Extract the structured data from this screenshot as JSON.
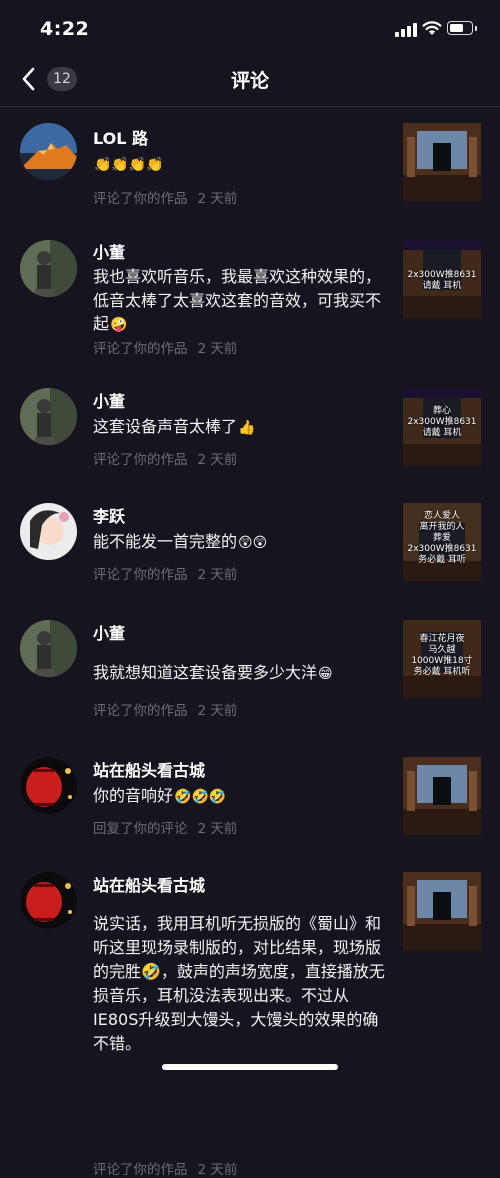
{
  "status": {
    "time": "4:22"
  },
  "nav": {
    "title": "评论",
    "badge_count": "12"
  },
  "comments": [
    {
      "username": "LOL 路",
      "text": "",
      "emoji": "👏👏👏👏",
      "action": "评论了你的作品",
      "time": "2 天前",
      "thumb_text": "",
      "avatar": "mountain"
    },
    {
      "username": "小董",
      "text": "我也喜欢听音乐，我最喜欢这种效果的，低音太棒了太喜欢这套的音效，可我买不起",
      "emoji": "🤪",
      "action": "评论了你的作品",
      "time": "2 天前",
      "thumb_text": "2x300W推8631\n请戴 耳机",
      "avatar": "statue"
    },
    {
      "username": "小董",
      "text": "这套设备声音太棒了",
      "emoji": "👍",
      "action": "评论了你的作品",
      "time": "2 天前",
      "thumb_text": "葬心\n2x300W推8631\n请戴 耳机",
      "avatar": "statue"
    },
    {
      "username": "李跃",
      "text": "能不能发一首完整的",
      "emoji": "😲😲",
      "action": "评论了你的作品",
      "time": "2 天前",
      "thumb_text": "恋人爱人\n离开我的人\n葬爱\n2x300W推8631\n务必戴 耳听",
      "avatar": "girl"
    },
    {
      "username": "小董",
      "text": "我就想知道这套设备要多少大洋",
      "emoji": "😁",
      "action": "评论了你的作品",
      "time": "2 天前",
      "thumb_text": "春江花月夜\n马久越\n1000W推18寸\n务必戴 耳机听",
      "avatar": "statue"
    },
    {
      "username": "站在船头看古城",
      "text": "你的音响好",
      "emoji": "🤣🤣🤣",
      "action": "回复了你的评论",
      "time": "2 天前",
      "thumb_text": "",
      "avatar": "lantern"
    },
    {
      "username": "站在船头看古城",
      "text": "说实话，我用耳机听无损版的《蜀山》和听这里现场录制版的，对比结果，现场版的完胜🤣，鼓声的声场宽度，直接播放无损音乐，耳机没法表现出来。不过从IE80S升级到大馒头，大馒头的效果的确不错。",
      "emoji": "",
      "action": "评论了你的作品",
      "time": "2 天前",
      "thumb_text": "",
      "avatar": "lantern"
    }
  ]
}
